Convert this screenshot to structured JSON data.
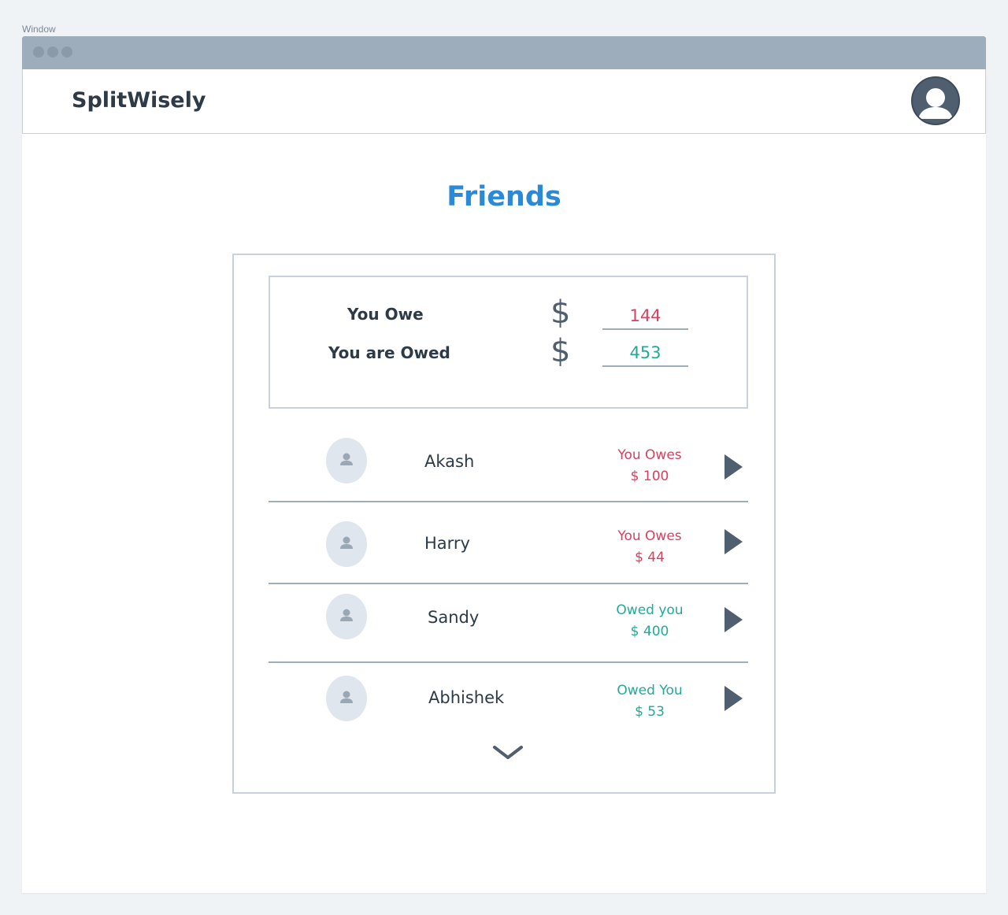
{
  "window": {
    "label": "Window"
  },
  "app": {
    "name": "SplitWisely",
    "avatar_icon": "user-avatar-icon"
  },
  "page": {
    "title": "Friends"
  },
  "summary": {
    "you_owe_label": "You Owe",
    "you_are_owed_label": "You are Owed",
    "currency_symbol": "$",
    "you_owe_value": "144",
    "you_are_owed_value": "453"
  },
  "friends": [
    {
      "name": "Akash",
      "status": "You Owes",
      "amount": "$ 100",
      "kind": "owe"
    },
    {
      "name": "Harry",
      "status": "You Owes",
      "amount": "$ 44",
      "kind": "owe"
    },
    {
      "name": "Sandy",
      "status": "Owed you",
      "amount": "$ 400",
      "kind": "owed"
    },
    {
      "name": "Abhishek",
      "status": "Owed You",
      "amount": "$ 53",
      "kind": "owed"
    }
  ],
  "colors": {
    "accent": "#2b8ad8",
    "owe": "#d6415f",
    "owed": "#22a99a",
    "titlebar": "#9eadbb"
  },
  "icons": {
    "row_arrow": "play-arrow-icon",
    "more": "chevron-down-icon",
    "friend_avatar": "person-icon"
  }
}
